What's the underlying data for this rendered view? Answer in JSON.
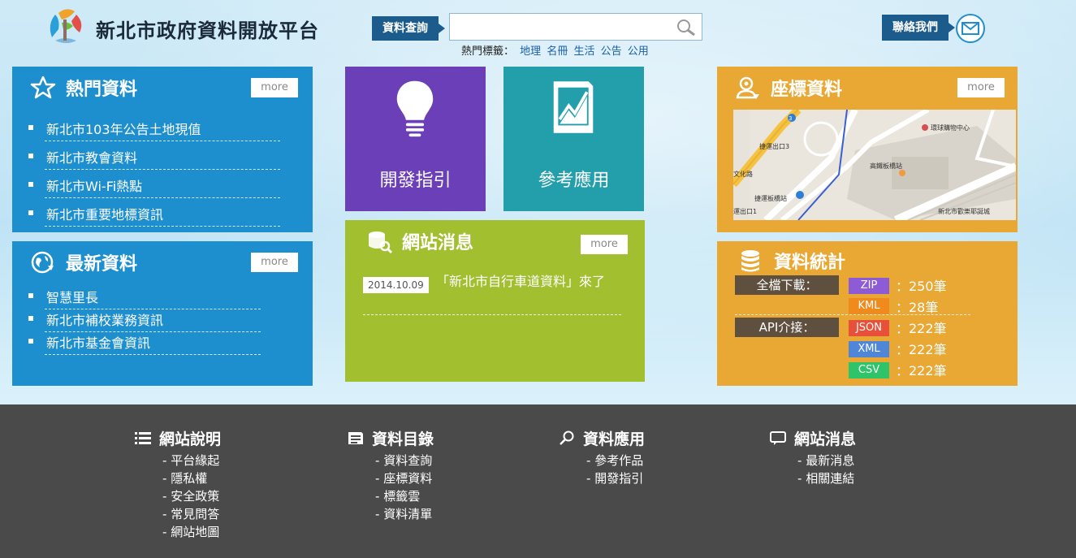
{
  "header": {
    "site_title": "新北市政府資料開放平台",
    "search_label": "資料查詢",
    "search_value": "",
    "hot_tags_label": "熱門標籤：",
    "hot_tags": [
      "地理",
      "名冊",
      "生活",
      "公告",
      "公用"
    ],
    "contact_label": "聯絡我們"
  },
  "popular": {
    "title": "熱門資料",
    "more": "more",
    "items": [
      "新北市103年公告土地現值",
      "新北市教會資料",
      "新北市Wi-Fi熱點",
      "新北市重要地標資訊"
    ]
  },
  "latest": {
    "title": "最新資料",
    "more": "more",
    "items": [
      "智慧里長",
      "新北市補校業務資訊",
      "新北市基金會資訊"
    ]
  },
  "tiles": {
    "dev_guide": "開發指引",
    "reference_apps": "參考應用"
  },
  "site_news": {
    "title": "網站消息",
    "more": "more",
    "date": "2014.10.09",
    "text": "「新北市自行車道資料」來了"
  },
  "coordinates": {
    "title": "座標資料",
    "more": "more",
    "map_labels": [
      "環球購物中心",
      "捷運出口3",
      "高鐵板橋站",
      "文化路",
      "捷運板橋站",
      "運出口1",
      "新北市歡樂耶誕城",
      "3"
    ]
  },
  "stats": {
    "title": "資料統計",
    "full_download": "全檔下載：",
    "api": "API介接：",
    "rows": [
      {
        "format": "ZIP",
        "count": "：250筆",
        "color": "#8e5bd6"
      },
      {
        "format": "KML",
        "count": "：28筆",
        "color": "#f08a1c"
      },
      {
        "format": "JSON",
        "count": "：222筆",
        "color": "#e8503a"
      },
      {
        "format": "XML",
        "count": "：222筆",
        "color": "#4f86d8"
      },
      {
        "format": "CSV",
        "count": "：222筆",
        "color": "#2fc46a"
      }
    ]
  },
  "footer": {
    "columns": [
      {
        "title": "網站說明",
        "icon": "list-icon",
        "items": [
          "平台緣起",
          "隱私權",
          "安全政策",
          "常見問答",
          "網站地圖"
        ]
      },
      {
        "title": "資料目錄",
        "icon": "catalog-icon",
        "items": [
          "資料查詢",
          "座標資料",
          "標籤雲",
          "資料清單"
        ]
      },
      {
        "title": "資料應用",
        "icon": "search-icon",
        "items": [
          "參考作品",
          "開發指引"
        ]
      },
      {
        "title": "網站消息",
        "icon": "chat-icon",
        "items": [
          "最新消息",
          "相關連結"
        ]
      }
    ]
  }
}
